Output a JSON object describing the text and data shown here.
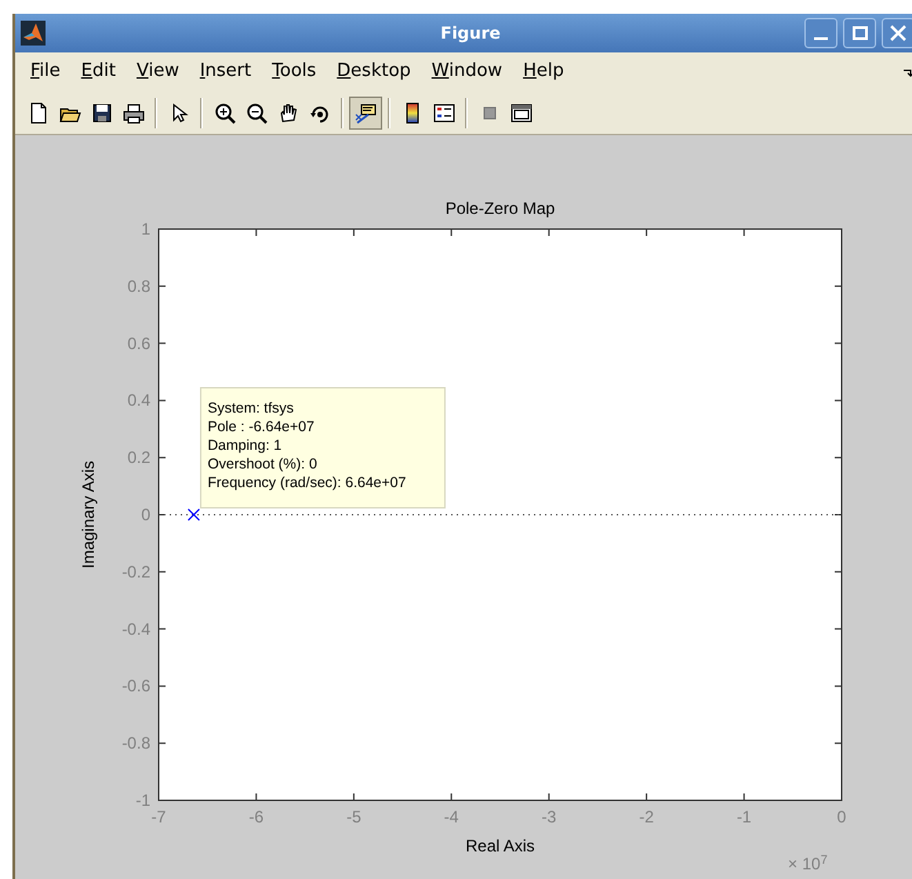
{
  "window": {
    "title": "Figure"
  },
  "menu": [
    {
      "label": "File"
    },
    {
      "label": "Edit"
    },
    {
      "label": "View"
    },
    {
      "label": "Insert"
    },
    {
      "label": "Tools"
    },
    {
      "label": "Desktop"
    },
    {
      "label": "Window"
    },
    {
      "label": "Help"
    }
  ],
  "toolbar": [
    [
      {
        "kind": "new",
        "selected": false
      },
      {
        "kind": "open",
        "selected": false
      },
      {
        "kind": "save",
        "selected": false
      },
      {
        "kind": "print",
        "selected": false
      }
    ],
    [
      {
        "kind": "pointer",
        "selected": false
      }
    ],
    [
      {
        "kind": "zoom-in",
        "selected": false
      },
      {
        "kind": "zoom-out",
        "selected": false
      },
      {
        "kind": "pan",
        "selected": false
      },
      {
        "kind": "rotate",
        "selected": false
      }
    ],
    [
      {
        "kind": "data-cursor",
        "selected": true
      }
    ],
    [
      {
        "kind": "colorbar",
        "selected": false
      },
      {
        "kind": "legend",
        "selected": false
      }
    ],
    [
      {
        "kind": "hide-tools",
        "selected": false
      },
      {
        "kind": "show-tools",
        "selected": false
      }
    ]
  ],
  "plot": {
    "chart_data": {
      "type": "scatter",
      "title": "Pole-Zero Map",
      "xlabel": "Real Axis",
      "ylabel": "Imaginary Axis",
      "xlim": [
        -7,
        0
      ],
      "ylim": [
        -1,
        1
      ],
      "xticks": [
        -7,
        -6,
        -5,
        -4,
        -3,
        -2,
        -1,
        0
      ],
      "yticks": [
        -1,
        -0.8,
        -0.6,
        -0.4,
        -0.2,
        0,
        0.2,
        0.4,
        0.6,
        0.8,
        1
      ],
      "x": [
        -6.64
      ],
      "series": [
        {
          "color": "#0000ff",
          "values": [
            0
          ]
        }
      ]
    },
    "x_multiplier": "× 10$^{7}$",
    "datatip": [
      "System: tfsys",
      "Pole : -6.64e+07",
      "Damping: 1",
      "Overshoot (%): 0",
      "Frequency (rad/sec): 6.64e+07"
    ]
  }
}
